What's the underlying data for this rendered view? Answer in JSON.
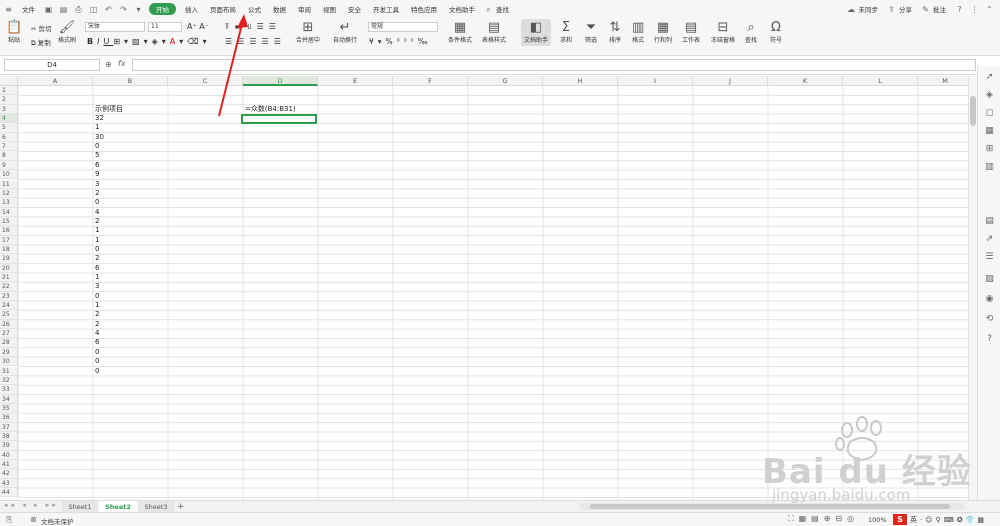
{
  "menubar": {
    "file": "文件",
    "tabs": [
      "开始",
      "插入",
      "页面布局",
      "公式",
      "数据",
      "审阅",
      "视图",
      "安全",
      "开发工具",
      "特色应用",
      "文档助手"
    ],
    "active_tab": 0,
    "search": "查找",
    "sync": "未同步",
    "share": "分享",
    "comment": "批注"
  },
  "ribbon": {
    "cut": "剪切",
    "paste": "粘贴",
    "copy": "复制",
    "format_painter": "格式刷",
    "font_name": "宋体",
    "font_size": "11",
    "merge_center": "合并居中",
    "wrap": "自动换行",
    "number_format": "常规",
    "cond_format": "条件格式",
    "table_style": "表格样式",
    "doc_helper": "文档助手",
    "sum": "求和",
    "filter": "筛选",
    "sort": "排序",
    "format": "格式",
    "row_col": "行和列",
    "worksheet": "工作表",
    "freeze": "冻结窗格",
    "find": "查找",
    "symbol": "符号"
  },
  "formula_bar": {
    "name_box": "D4",
    "fx": "fx",
    "content": ""
  },
  "columns": [
    "A",
    "B",
    "C",
    "D",
    "E",
    "F",
    "G",
    "H",
    "I",
    "J",
    "K",
    "L",
    "M"
  ],
  "rows": [
    "1",
    "2",
    "3",
    "4",
    "5",
    "6",
    "7",
    "8",
    "9",
    "10",
    "11",
    "12",
    "13",
    "14",
    "15",
    "16",
    "17",
    "18",
    "19",
    "20",
    "21",
    "22",
    "23",
    "24",
    "25",
    "26",
    "27",
    "28",
    "29",
    "30",
    "31",
    "32",
    "33",
    "34",
    "35",
    "36",
    "37",
    "38",
    "39",
    "40",
    "41",
    "42",
    "43",
    "44"
  ],
  "cells": {
    "B3": "示例项目",
    "B_values": [
      "32",
      "1",
      "30",
      "0",
      "5",
      "6",
      "9",
      "3",
      "2",
      "0",
      "4",
      "2",
      "1",
      "1",
      "0",
      "2",
      "6",
      "1",
      "3",
      "0",
      "1",
      "2",
      "2",
      "4",
      "6",
      "0",
      "0",
      "0"
    ],
    "D3": "=众数(B4:B31)"
  },
  "sheets": [
    "Sheet1",
    "Sheet2",
    "Sheet3"
  ],
  "active_sheet": 1,
  "status": {
    "protect": "文档未保护",
    "zoom": "100%"
  },
  "watermark": {
    "brand": "Bai du 经验",
    "url": "jingyan.baidu.com"
  },
  "colors": {
    "accent": "#2e9b4f",
    "arrow": "#e02020"
  }
}
